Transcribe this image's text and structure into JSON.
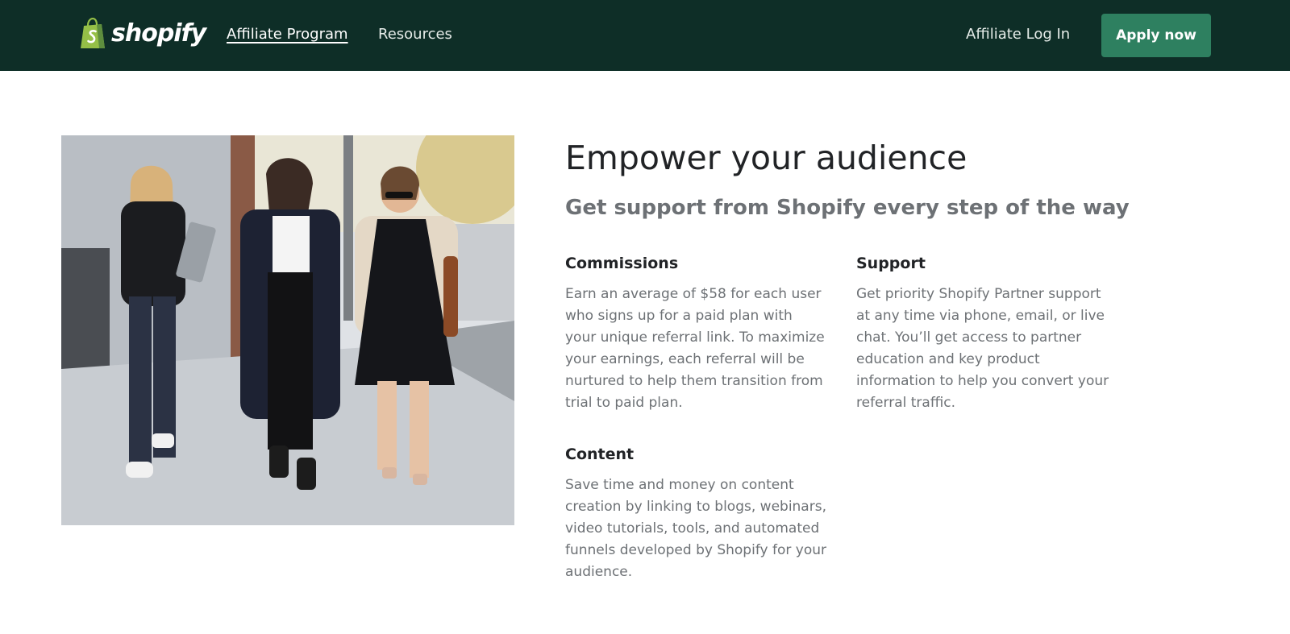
{
  "header": {
    "brand": "shopify",
    "nav": {
      "affiliate_program": "Affiliate Program",
      "resources": "Resources",
      "affiliate_login": "Affiliate Log In"
    },
    "apply_label": "Apply now"
  },
  "main": {
    "headline": "Empower your audience",
    "subheadline": "Get support from Shopify every step of the way",
    "features": {
      "commissions": {
        "title": "Commissions",
        "body": "Earn an average of $58 for each user who signs up for a paid plan with your unique referral link. To maximize your earnings, each referral will be nurtured to help them transition from trial to paid plan."
      },
      "support": {
        "title": "Support",
        "body": "Get priority Shopify Partner support at any time via phone, email, or live chat. You’ll get access to partner education and key product information to help you convert your referral traffic."
      },
      "content": {
        "title": "Content",
        "body": "Save time and money on content creation by linking to blogs, webinars, video tutorials, tools, and automated funnels developed by Shopify for your audience."
      }
    }
  },
  "colors": {
    "header_bg": "#0e2e27",
    "accent_button": "#2e8060",
    "logo_green": "#95bf47",
    "muted_text": "#6d7175"
  }
}
